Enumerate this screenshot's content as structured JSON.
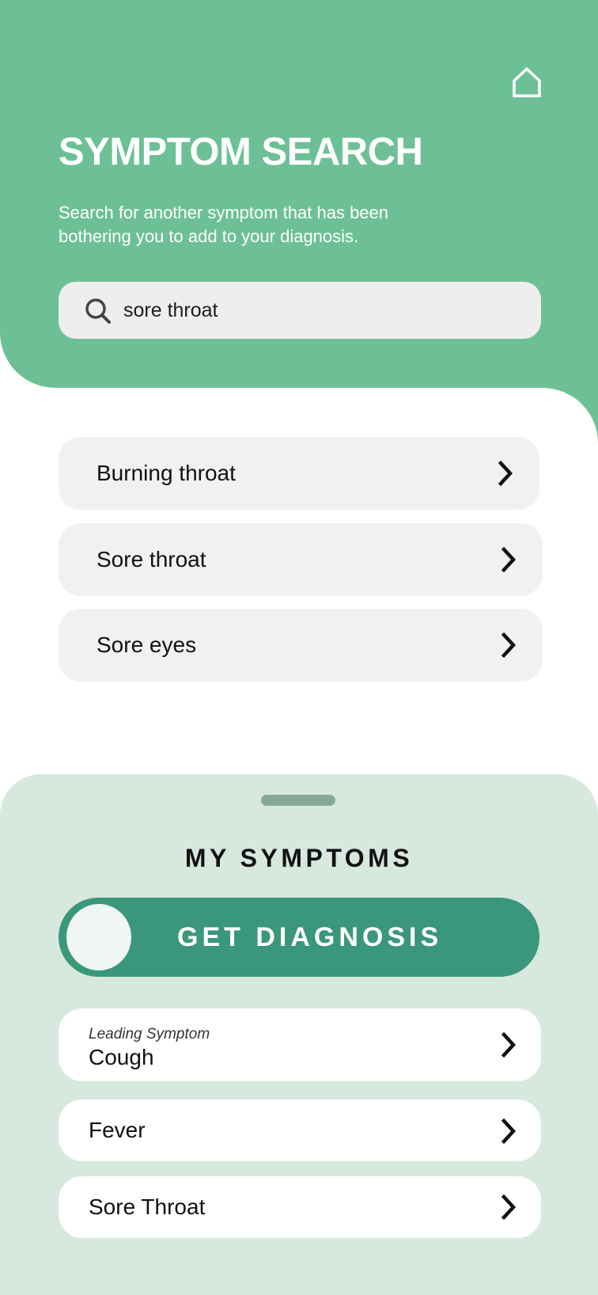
{
  "header": {
    "title": "SYMPTOM SEARCH",
    "subtitle": "Search for another symptom that has been bothering you to add to your diagnosis.",
    "home_icon": "home-icon",
    "background_color": "#6dc096"
  },
  "search": {
    "icon": "search-icon",
    "value": "sore throat"
  },
  "results": [
    {
      "label": "Burning throat",
      "icon": "chevron-right-icon"
    },
    {
      "label": "Sore throat",
      "icon": "chevron-right-icon"
    },
    {
      "label": "Sore eyes",
      "icon": "chevron-right-icon"
    }
  ],
  "my_symptoms": {
    "title": "MY SYMPTOMS",
    "diagnosis_button": "GET DIAGNOSIS",
    "accent_color": "#3a977c",
    "sheet_color": "#d7e8df",
    "items": [
      {
        "tag": "Leading Symptom",
        "label": "Cough"
      },
      {
        "label": "Fever"
      },
      {
        "label": "Sore Throat"
      }
    ]
  }
}
